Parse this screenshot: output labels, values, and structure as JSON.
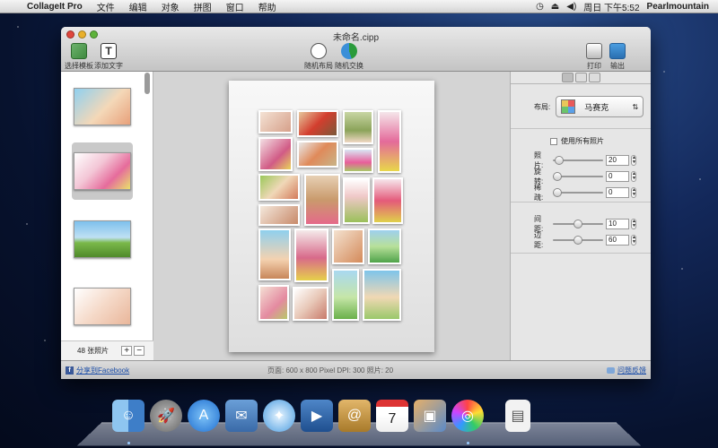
{
  "menubar": {
    "apple": "",
    "app": "CollageIt Pro",
    "items": [
      "文件",
      "编辑",
      "对象",
      "拼图",
      "窗口",
      "帮助"
    ],
    "clock": "周日 下午5:52",
    "user": "Pearlmountain"
  },
  "window": {
    "title": "未命名.cipp"
  },
  "toolbar": {
    "choose_template": "选择模板",
    "add_text": "添加文字",
    "random_layout": "随机布局",
    "random_swap": "随机交换",
    "print": "打印",
    "export": "输出"
  },
  "sidebar": {
    "photo_count": "48 张照片",
    "add": "+",
    "remove": "−"
  },
  "inspector": {
    "layout_label": "布局:",
    "layout_value": "马赛克",
    "use_all_label": "使用所有照片",
    "photos_label": "照片:",
    "photos_value": "20",
    "photos_level": 0.05,
    "rotate_label": "旋转:",
    "rotate_value": "0",
    "rotate_level": 0,
    "scatter_label": "稀疏:",
    "scatter_value": "0",
    "scatter_level": 0,
    "spacing_label": "间距:",
    "spacing_value": "10",
    "spacing_level": 0.5,
    "margin_label": "边距:",
    "margin_value": "60",
    "margin_level": 0.5
  },
  "status": {
    "share": "分享到Facebook",
    "info": "页面: 600 x 800 Pixel  DPI: 300 照片: 20",
    "feedback": "问题反馈"
  }
}
